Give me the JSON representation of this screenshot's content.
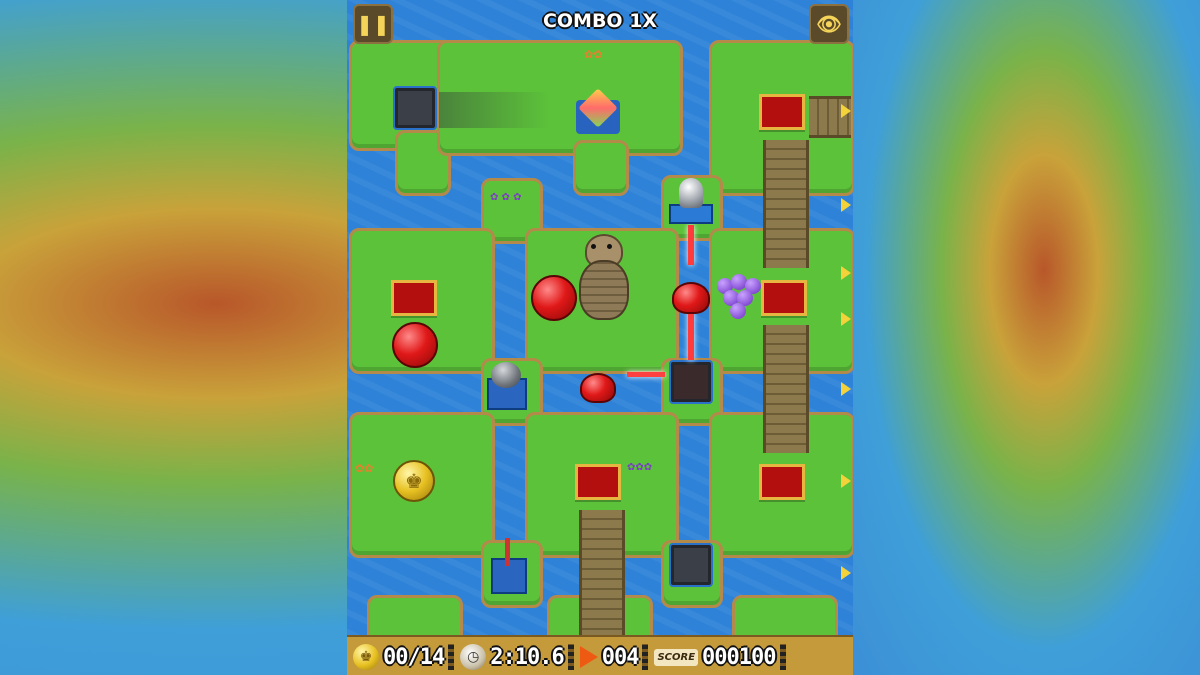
{
  "combo_text": "COMBO 1X",
  "hud": {
    "coins": "00/14",
    "timer": "2:10.6",
    "moves": "004",
    "score_label": "SCORE",
    "score": "000100"
  },
  "buttons": {
    "pause_icon": "pause-icon",
    "view_icon": "eye-icon"
  },
  "colors": {
    "water": "#2e83d8",
    "grass": "#5cc23a",
    "carpet": "#b40f0f",
    "laser": "#ff3b3b",
    "hud": "#c49a3a"
  }
}
